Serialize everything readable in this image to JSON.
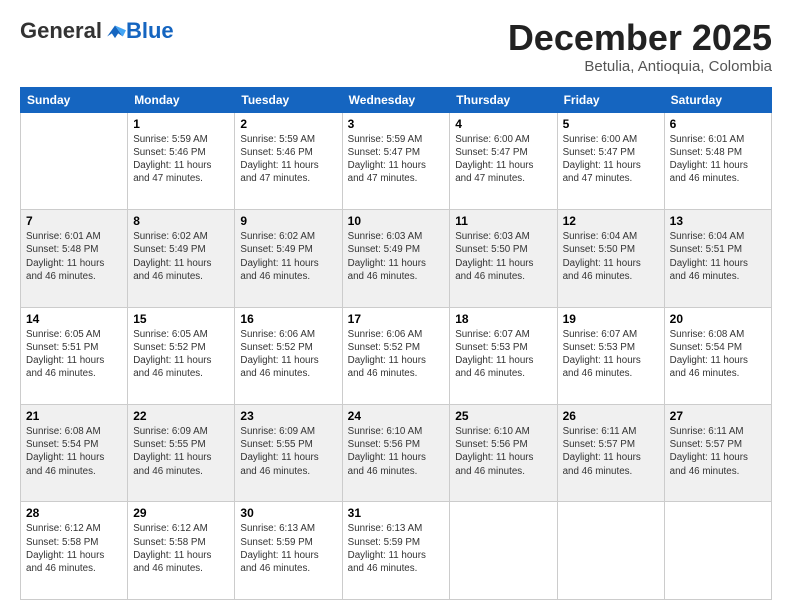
{
  "header": {
    "logo_general": "General",
    "logo_blue": "Blue",
    "month_title": "December 2025",
    "location": "Betulia, Antioquia, Colombia"
  },
  "days_of_week": [
    "Sunday",
    "Monday",
    "Tuesday",
    "Wednesday",
    "Thursday",
    "Friday",
    "Saturday"
  ],
  "weeks": [
    [
      {
        "day": "",
        "info": ""
      },
      {
        "day": "1",
        "info": "Sunrise: 5:59 AM\nSunset: 5:46 PM\nDaylight: 11 hours\nand 47 minutes."
      },
      {
        "day": "2",
        "info": "Sunrise: 5:59 AM\nSunset: 5:46 PM\nDaylight: 11 hours\nand 47 minutes."
      },
      {
        "day": "3",
        "info": "Sunrise: 5:59 AM\nSunset: 5:47 PM\nDaylight: 11 hours\nand 47 minutes."
      },
      {
        "day": "4",
        "info": "Sunrise: 6:00 AM\nSunset: 5:47 PM\nDaylight: 11 hours\nand 47 minutes."
      },
      {
        "day": "5",
        "info": "Sunrise: 6:00 AM\nSunset: 5:47 PM\nDaylight: 11 hours\nand 47 minutes."
      },
      {
        "day": "6",
        "info": "Sunrise: 6:01 AM\nSunset: 5:48 PM\nDaylight: 11 hours\nand 46 minutes."
      }
    ],
    [
      {
        "day": "7",
        "info": "Sunrise: 6:01 AM\nSunset: 5:48 PM\nDaylight: 11 hours\nand 46 minutes."
      },
      {
        "day": "8",
        "info": "Sunrise: 6:02 AM\nSunset: 5:49 PM\nDaylight: 11 hours\nand 46 minutes."
      },
      {
        "day": "9",
        "info": "Sunrise: 6:02 AM\nSunset: 5:49 PM\nDaylight: 11 hours\nand 46 minutes."
      },
      {
        "day": "10",
        "info": "Sunrise: 6:03 AM\nSunset: 5:49 PM\nDaylight: 11 hours\nand 46 minutes."
      },
      {
        "day": "11",
        "info": "Sunrise: 6:03 AM\nSunset: 5:50 PM\nDaylight: 11 hours\nand 46 minutes."
      },
      {
        "day": "12",
        "info": "Sunrise: 6:04 AM\nSunset: 5:50 PM\nDaylight: 11 hours\nand 46 minutes."
      },
      {
        "day": "13",
        "info": "Sunrise: 6:04 AM\nSunset: 5:51 PM\nDaylight: 11 hours\nand 46 minutes."
      }
    ],
    [
      {
        "day": "14",
        "info": "Sunrise: 6:05 AM\nSunset: 5:51 PM\nDaylight: 11 hours\nand 46 minutes."
      },
      {
        "day": "15",
        "info": "Sunrise: 6:05 AM\nSunset: 5:52 PM\nDaylight: 11 hours\nand 46 minutes."
      },
      {
        "day": "16",
        "info": "Sunrise: 6:06 AM\nSunset: 5:52 PM\nDaylight: 11 hours\nand 46 minutes."
      },
      {
        "day": "17",
        "info": "Sunrise: 6:06 AM\nSunset: 5:52 PM\nDaylight: 11 hours\nand 46 minutes."
      },
      {
        "day": "18",
        "info": "Sunrise: 6:07 AM\nSunset: 5:53 PM\nDaylight: 11 hours\nand 46 minutes."
      },
      {
        "day": "19",
        "info": "Sunrise: 6:07 AM\nSunset: 5:53 PM\nDaylight: 11 hours\nand 46 minutes."
      },
      {
        "day": "20",
        "info": "Sunrise: 6:08 AM\nSunset: 5:54 PM\nDaylight: 11 hours\nand 46 minutes."
      }
    ],
    [
      {
        "day": "21",
        "info": "Sunrise: 6:08 AM\nSunset: 5:54 PM\nDaylight: 11 hours\nand 46 minutes."
      },
      {
        "day": "22",
        "info": "Sunrise: 6:09 AM\nSunset: 5:55 PM\nDaylight: 11 hours\nand 46 minutes."
      },
      {
        "day": "23",
        "info": "Sunrise: 6:09 AM\nSunset: 5:55 PM\nDaylight: 11 hours\nand 46 minutes."
      },
      {
        "day": "24",
        "info": "Sunrise: 6:10 AM\nSunset: 5:56 PM\nDaylight: 11 hours\nand 46 minutes."
      },
      {
        "day": "25",
        "info": "Sunrise: 6:10 AM\nSunset: 5:56 PM\nDaylight: 11 hours\nand 46 minutes."
      },
      {
        "day": "26",
        "info": "Sunrise: 6:11 AM\nSunset: 5:57 PM\nDaylight: 11 hours\nand 46 minutes."
      },
      {
        "day": "27",
        "info": "Sunrise: 6:11 AM\nSunset: 5:57 PM\nDaylight: 11 hours\nand 46 minutes."
      }
    ],
    [
      {
        "day": "28",
        "info": "Sunrise: 6:12 AM\nSunset: 5:58 PM\nDaylight: 11 hours\nand 46 minutes."
      },
      {
        "day": "29",
        "info": "Sunrise: 6:12 AM\nSunset: 5:58 PM\nDaylight: 11 hours\nand 46 minutes."
      },
      {
        "day": "30",
        "info": "Sunrise: 6:13 AM\nSunset: 5:59 PM\nDaylight: 11 hours\nand 46 minutes."
      },
      {
        "day": "31",
        "info": "Sunrise: 6:13 AM\nSunset: 5:59 PM\nDaylight: 11 hours\nand 46 minutes."
      },
      {
        "day": "",
        "info": ""
      },
      {
        "day": "",
        "info": ""
      },
      {
        "day": "",
        "info": ""
      }
    ]
  ]
}
